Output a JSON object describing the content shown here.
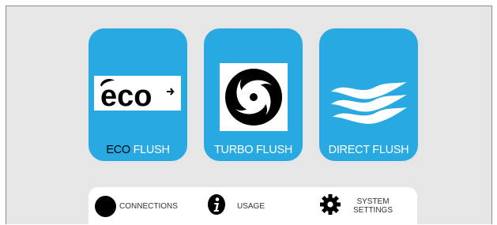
{
  "tiles": [
    {
      "logo_text": "eco",
      "label_dark": "ECO",
      "label_light": " FLUSH",
      "icon": "eco-leaf-icon"
    },
    {
      "label": "TURBO FLUSH",
      "icon": "turbo-swirl-icon"
    },
    {
      "label": "DIRECT FLUSH",
      "icon": "water-wave-icon"
    }
  ],
  "nav": [
    {
      "label": "CONNECTIONS",
      "icon": "connections-dot-icon"
    },
    {
      "label": "USAGE",
      "icon": "info-icon"
    },
    {
      "label_line1": "SYSTEM",
      "label_line2": "SETTINGS",
      "icon": "gear-icon"
    }
  ],
  "colors": {
    "tile_blue": "#29a9e1",
    "background": "#e6e6e6",
    "bar": "#ffffff"
  }
}
